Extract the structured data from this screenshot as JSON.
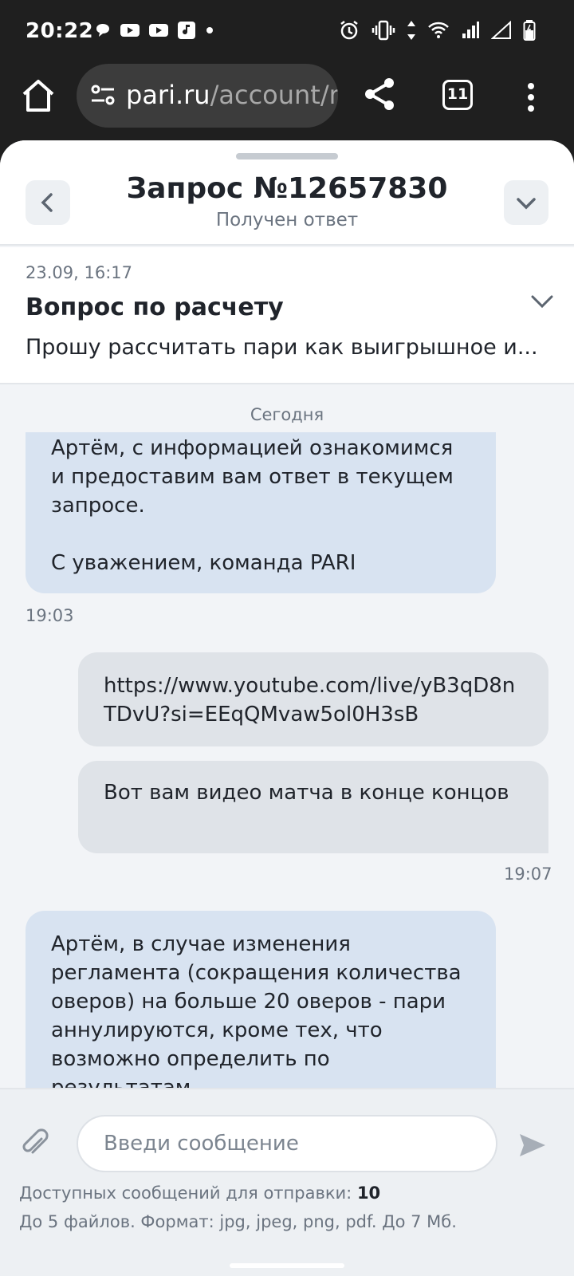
{
  "status_bar": {
    "time": "20:22",
    "left_icons": [
      "chat-bubble-icon",
      "youtube-icon",
      "youtube-icon",
      "music-note-icon",
      "dot-icon"
    ],
    "right_icons": [
      "alarm-icon",
      "vibrate-icon",
      "data-arrows-icon",
      "wifi-icon",
      "signal-icon",
      "signal-empty-icon",
      "battery-icon"
    ]
  },
  "browser": {
    "url_host": "pari.ru",
    "url_path": "/account/re",
    "tab_count": "11"
  },
  "header": {
    "title": "Запрос №12657830",
    "status": "Получен ответ"
  },
  "request": {
    "date": "23.09, 16:17",
    "subject": "Вопрос по расчету",
    "preview": "Прошу рассчитать пари как выигрышное и..."
  },
  "chat": {
    "day_label": "Сегодня",
    "messages": [
      {
        "direction": "in",
        "text": "Артём, с информацией ознакомимся и предоставим вам ответ в текущем запросе.\n\nС уважением, команда PARI",
        "time": "19:03"
      },
      {
        "direction": "out",
        "text": "https://www.youtube.com/live/yB3qD8nTDvU?si=EEqQMvaw5ol0H3sB"
      },
      {
        "direction": "out",
        "text": "Вот вам видео матча в конце концов",
        "time": "19:07"
      },
      {
        "direction": "in",
        "text": "Артём, в случае изменения регламента (сокращения количества оверов) на больше 20 оверов - пари аннулируются, кроме тех, что возможно определить по результатам"
      }
    ]
  },
  "composer": {
    "placeholder": "Введи сообщение",
    "limit_label": "Доступных сообщений для отправки:",
    "limit_value": "10",
    "files_note": "До 5 файлов. Формат: jpg, jpeg, png, pdf. До 7 Мб."
  },
  "colors": {
    "incoming_bubble": "#d8e3f1",
    "outgoing_bubble": "#dfe3e8",
    "background": "#f2f4f7"
  }
}
